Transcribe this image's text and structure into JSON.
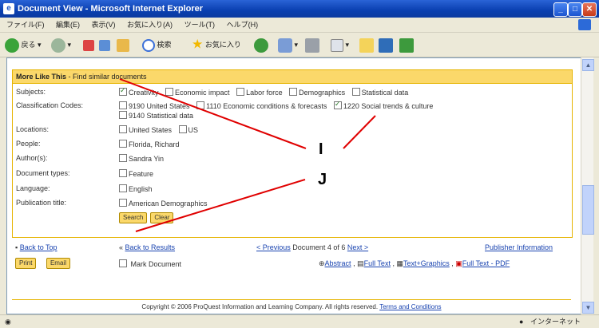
{
  "window": {
    "title": "Document View - Microsoft Internet Explorer",
    "controls": {
      "minimize": "_",
      "maximize": "□",
      "close": "✕"
    }
  },
  "menubar": {
    "items": [
      "ファイル(F)",
      "編集(E)",
      "表示(V)",
      "お気に入り(A)",
      "ツール(T)",
      "ヘルプ(H)"
    ]
  },
  "toolbar": {
    "back": "戻る",
    "search": "検索",
    "favorites": "お気に入り"
  },
  "panel": {
    "title": "More Like This",
    "subtitle": " - Find similar documents",
    "rows": [
      {
        "label": "Subjects:",
        "items": [
          {
            "text": "Creativity",
            "checked": true
          },
          {
            "text": "Economic impact",
            "checked": false
          },
          {
            "text": "Labor force",
            "checked": false
          },
          {
            "text": "Demographics",
            "checked": false
          },
          {
            "text": "Statistical data",
            "checked": false
          }
        ]
      },
      {
        "label": "Classification Codes:",
        "items": [
          {
            "text": "9190 United States",
            "checked": false
          },
          {
            "text": "1110 Economic conditions & forecasts",
            "checked": false
          },
          {
            "text": "1220 Social trends & culture",
            "checked": true
          }
        ],
        "items2": [
          {
            "text": "9140 Statistical data",
            "checked": false
          }
        ]
      },
      {
        "label": "Locations:",
        "items": [
          {
            "text": "United States",
            "checked": false
          },
          {
            "text": "US",
            "checked": false
          }
        ]
      },
      {
        "label": "People:",
        "items": [
          {
            "text": "Florida, Richard",
            "checked": false
          }
        ]
      },
      {
        "label": "Author(s):",
        "items": [
          {
            "text": "Sandra Yin",
            "checked": false
          }
        ]
      },
      {
        "label": "Document types:",
        "items": [
          {
            "text": "Feature",
            "checked": false
          }
        ]
      },
      {
        "label": "Language:",
        "items": [
          {
            "text": "English",
            "checked": false
          }
        ]
      },
      {
        "label": "Publication title:",
        "items": [
          {
            "text": "American Demographics",
            "checked": false
          }
        ]
      }
    ],
    "search_label": "Search",
    "clear_label": "Clear"
  },
  "footer": {
    "back_to_top": "Back to Top",
    "back_to_results": "Back to Results",
    "previous": "< Previous",
    "doc_count": "Document 4 of 6",
    "next": "Next >",
    "publisher_info": "Publisher Information",
    "print": "Print",
    "email": "Email",
    "mark_document": "Mark Document",
    "abstract": "Abstract",
    "full_text": "Full Text",
    "text_graphics": "Text+Graphics",
    "full_text_pdf": "Full Text - PDF"
  },
  "copyright": "Copyright © 2006 ProQuest Information and Learning Company. All rights reserved.",
  "terms": "Terms and Conditions",
  "status": {
    "zone": "インターネット"
  },
  "annotations": {
    "I": "I",
    "J": "J"
  },
  "colors": {
    "panel_header": "#fbd86a",
    "panel_border": "#e6b400",
    "annotation_line": "#e00000"
  }
}
